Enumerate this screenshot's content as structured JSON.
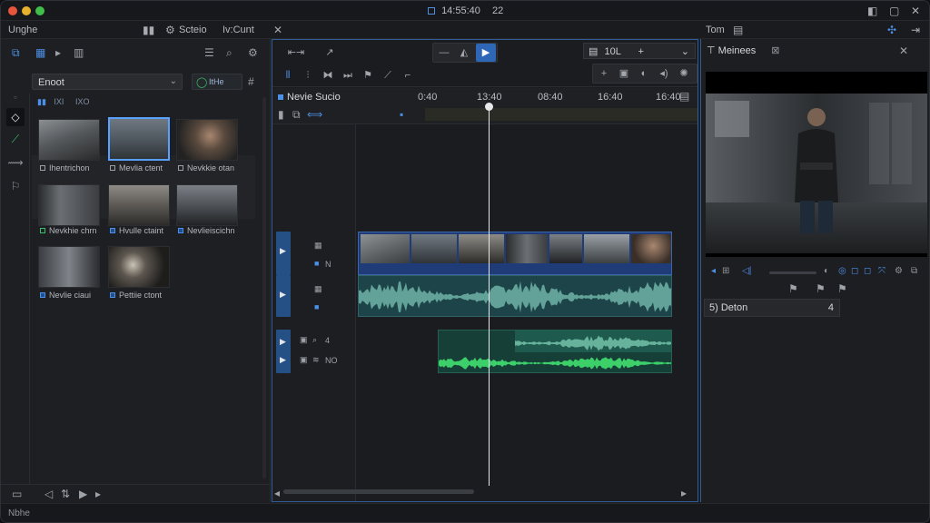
{
  "window": {
    "title": "14:55:40",
    "title_suffix": "22"
  },
  "menu": {
    "app_label": "Unghe",
    "workspace_label": "Scteio",
    "edit_label": "Iv:Cunt",
    "right_label": "Tom"
  },
  "media": {
    "bin_dropdown": "Enoot",
    "filter_label": "ItHe",
    "sort_a": "IXI",
    "sort_b": "IXO",
    "clips": [
      {
        "caption": "Ihentrichon"
      },
      {
        "caption": "Mevlia ctent"
      },
      {
        "caption": "Nevkkie otan"
      },
      {
        "caption": "Nevkhie chrn"
      },
      {
        "caption": "Hvulle ctaint"
      },
      {
        "caption": "Nevlieiscichn"
      },
      {
        "caption": "Nevlie ciaui"
      },
      {
        "caption": "Pettiie ctont"
      }
    ]
  },
  "toolbar": {
    "zoom_value": "10L"
  },
  "timeline": {
    "sequence_name": "Nevie Sucio",
    "timecodes": [
      "0:40",
      "13:40",
      "08:40",
      "16:40",
      "16:40"
    ],
    "track_labels": {
      "v1": "N",
      "a2": "4",
      "a3": "NO"
    }
  },
  "viewer": {
    "tab_label": "Meinees",
    "inspector_label": "5) Deton",
    "inspector_value": "4"
  },
  "status": {
    "text": "Nbhe"
  }
}
